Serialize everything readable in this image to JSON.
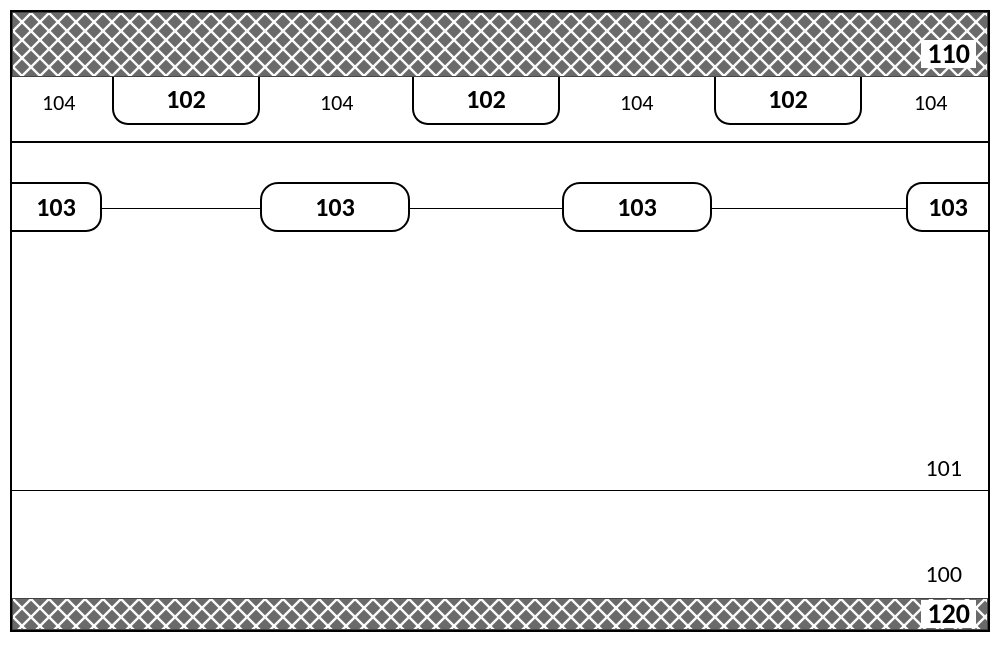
{
  "labels": {
    "top_band": "110",
    "bottom_band": "120",
    "layer_101": "101",
    "layer_100": "100",
    "pill_102": "102",
    "label_104": "104",
    "pill_103": "103"
  }
}
